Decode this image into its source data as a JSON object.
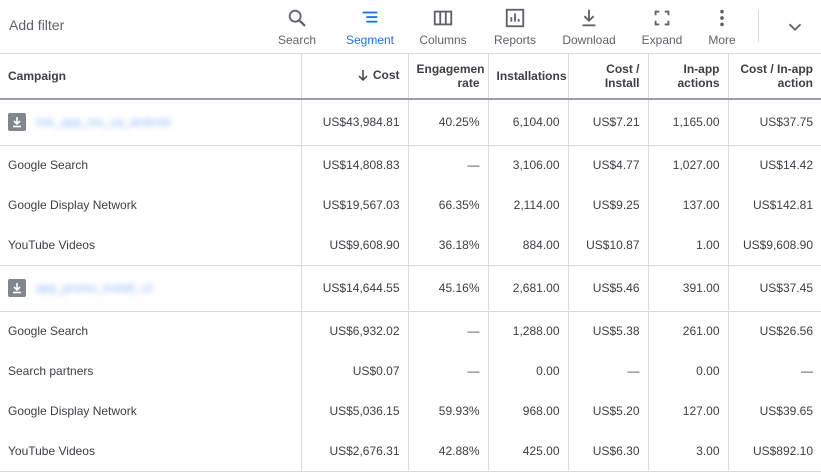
{
  "toolbar": {
    "add_filter": "Add filter",
    "buttons": [
      {
        "label": "Search",
        "icon": "search-icon"
      },
      {
        "label": "Segment",
        "icon": "segment-icon",
        "active": true
      },
      {
        "label": "Columns",
        "icon": "columns-icon"
      },
      {
        "label": "Reports",
        "icon": "reports-icon"
      },
      {
        "label": "Download",
        "icon": "download-icon"
      },
      {
        "label": "Expand",
        "icon": "expand-icon"
      },
      {
        "label": "More",
        "icon": "more-vert-icon"
      }
    ],
    "accent_color": "#1a73e8"
  },
  "table": {
    "headers": {
      "campaign": "Campaign",
      "cost": "Cost",
      "engagement_rate_l1": "Engagemen",
      "engagement_rate_l2": "rate",
      "installations": "Installations",
      "cost_install_l1": "Cost /",
      "cost_install_l2": "Install",
      "inapp_l1": "In-app",
      "inapp_l2": "actions",
      "cost_inapp_l1": "Cost / In-app",
      "cost_inapp_l2": "action"
    },
    "groups": [
      {
        "campaign": "mix_app_ios_ua_android",
        "total": [
          "US$43,984.81",
          "40.25%",
          "6,104.00",
          "US$7.21",
          "1,165.00",
          "US$37.75"
        ],
        "rows": [
          {
            "name": "Google Search",
            "vals": [
              "US$14,808.83",
              "—",
              "3,106.00",
              "US$4.77",
              "1,027.00",
              "US$14.42"
            ]
          },
          {
            "name": "Google Display Network",
            "vals": [
              "US$19,567.03",
              "66.35%",
              "2,114.00",
              "US$9.25",
              "137.00",
              "US$142.81"
            ]
          },
          {
            "name": "YouTube Videos",
            "vals": [
              "US$9,608.90",
              "36.18%",
              "884.00",
              "US$10.87",
              "1.00",
              "US$9,608.90"
            ]
          }
        ]
      },
      {
        "campaign": "app_promo_install_v2",
        "total": [
          "US$14,644.55",
          "45.16%",
          "2,681.00",
          "US$5.46",
          "391.00",
          "US$37.45"
        ],
        "rows": [
          {
            "name": "Google Search",
            "vals": [
              "US$6,932.02",
              "—",
              "1,288.00",
              "US$5.38",
              "261.00",
              "US$26.56"
            ]
          },
          {
            "name": "Search partners",
            "vals": [
              "US$0.07",
              "—",
              "0.00",
              "—",
              "0.00",
              "—"
            ]
          },
          {
            "name": "Google Display Network",
            "vals": [
              "US$5,036.15",
              "59.93%",
              "968.00",
              "US$5.20",
              "127.00",
              "US$39.65"
            ]
          },
          {
            "name": "YouTube Videos",
            "vals": [
              "US$2,676.31",
              "42.88%",
              "425.00",
              "US$6.30",
              "3.00",
              "US$892.10"
            ]
          }
        ]
      }
    ]
  }
}
